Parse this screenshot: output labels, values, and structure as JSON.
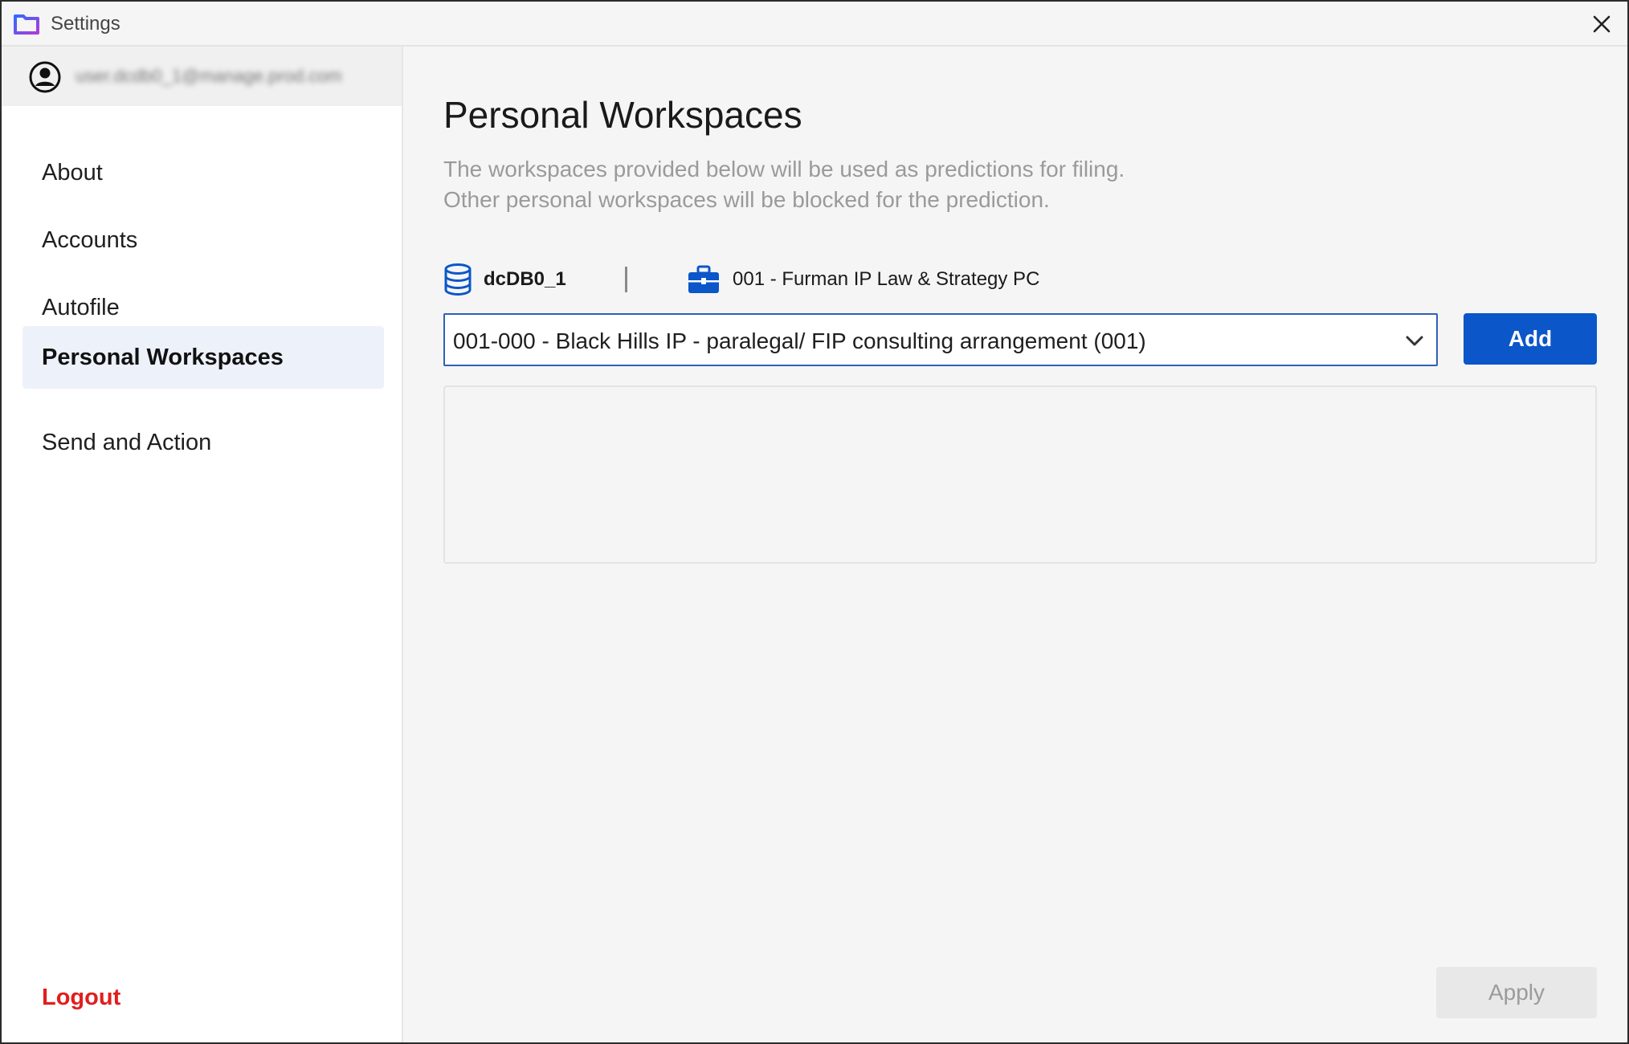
{
  "window": {
    "title": "Settings"
  },
  "sidebar": {
    "user_email": "user.dcdb0_1@manage.prod.com",
    "items": [
      {
        "label": "About",
        "active": false
      },
      {
        "label": "Accounts",
        "active": false
      },
      {
        "label": "Autofile",
        "active": false
      },
      {
        "label": "Personal Workspaces",
        "active": true
      },
      {
        "label": "Send and Action",
        "active": false
      }
    ],
    "logout_label": "Logout"
  },
  "main": {
    "title": "Personal Workspaces",
    "description_lines": [
      "The workspaces provided below will be used as predictions for filing.",
      "Other personal workspaces will be blocked for the prediction."
    ],
    "database": {
      "icon": "database-icon",
      "name": "dcDB0_1"
    },
    "client": {
      "icon": "briefcase-icon",
      "name": "001 - Furman IP Law & Strategy PC"
    },
    "workspace_select": {
      "value": "001-000 - Black Hills IP - paralegal/ FIP consulting arrangement (001)"
    },
    "add_label": "Add",
    "apply_label": "Apply"
  },
  "colors": {
    "accent": "#0b56c9",
    "active_nav_bg": "#edf2fa",
    "logout": "#e01e1e",
    "select_border": "#2f5fb8"
  }
}
